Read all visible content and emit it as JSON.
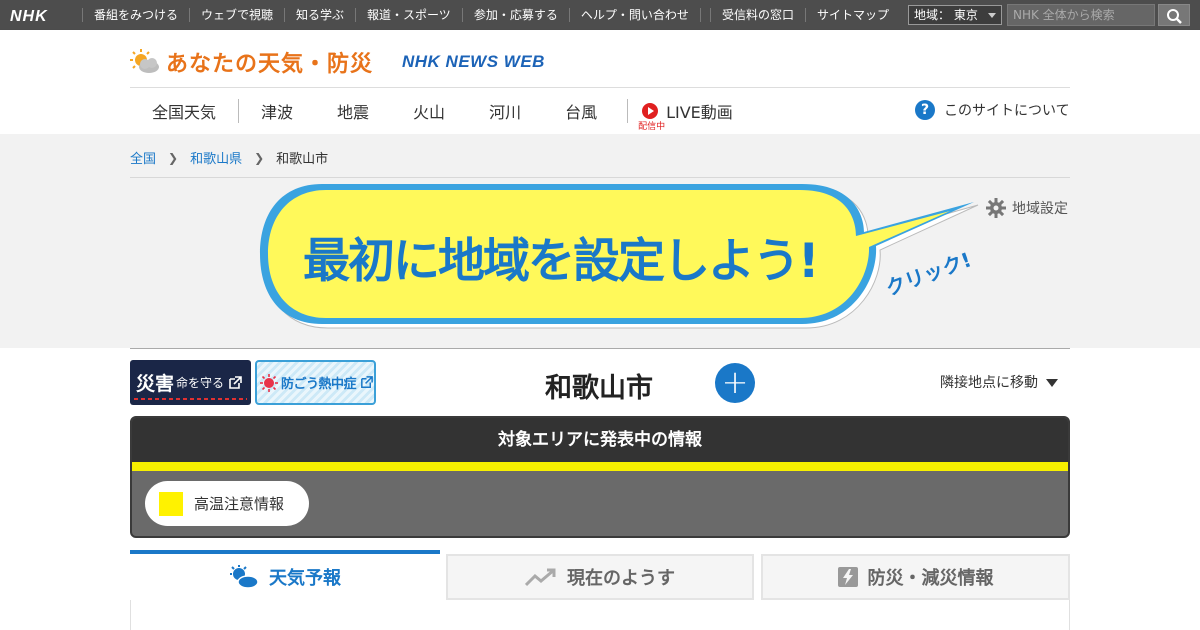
{
  "topbar": {
    "logo": "NHK",
    "nav": [
      "番組をみつける",
      "ウェブで視聴",
      "知る学ぶ",
      "報道・スポーツ",
      "参加・応募する",
      "ヘルプ・問い合わせ"
    ],
    "links": [
      "受信料の窓口",
      "サイトマップ"
    ],
    "region_select": "地域： 東京",
    "search_placeholder": "NHK 全体から検索"
  },
  "header": {
    "site_title": "あなたの天気・防災",
    "news_logo": "NHK NEWS WEB",
    "nav": [
      "全国天気",
      "津波",
      "地震",
      "火山",
      "河川",
      "台風"
    ],
    "live_label": "LIVE動画",
    "live_status": "配信中",
    "about_label": "このサイトについて"
  },
  "breadcrumb": [
    "全国",
    "和歌山県",
    "和歌山市"
  ],
  "settings_label": "地域設定",
  "banner": {
    "text": "最初に地域を設定しよう!",
    "click": "クリック!"
  },
  "buttons": {
    "saigai_big": "災害",
    "saigai_small": "命を守る",
    "necchu": "防ごう熱中症"
  },
  "city_name": "和歌山市",
  "add_label": "+",
  "nearby_label": "隣接地点に移動",
  "alert": {
    "heading": "対象エリアに発表中の情報",
    "item": "高温注意情報",
    "color": "#fff200"
  },
  "tabs": [
    "天気予報",
    "現在のようす",
    "防災・減災情報"
  ],
  "colors": {
    "accent": "#1a78c8",
    "title_orange": "#e8731a",
    "topbar": "#4d4d4d"
  }
}
